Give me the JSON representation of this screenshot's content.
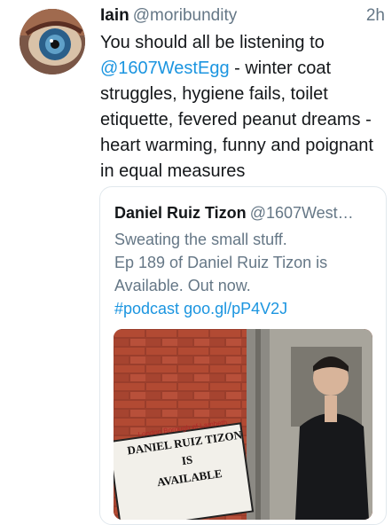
{
  "tweet": {
    "author_name": "Iain",
    "author_handle": "@moribundity",
    "time": "2h",
    "text_before": "You should all be listening to ",
    "mention": "@1607WestEgg",
    "text_after": " - winter coat struggles, hygiene fails, toilet etiquette, fevered peanut dreams - heart warming, funny and poignant in equal measures"
  },
  "quoted": {
    "author_name": "Daniel Ruiz Tizon",
    "author_handle": "@1607West…",
    "line1": "Sweating the small stuff.",
    "line2": "Ep 189 of Daniel Ruiz Tizon is Available. Out now.",
    "hashtag": "#podcast",
    "link": "goo.gl/pP4V2J",
    "sign_small": "London Borough of Lambeth",
    "sign_line1": "DANIEL RUIZ TIZON",
    "sign_line2": "IS",
    "sign_line3": "AVAILABLE"
  }
}
